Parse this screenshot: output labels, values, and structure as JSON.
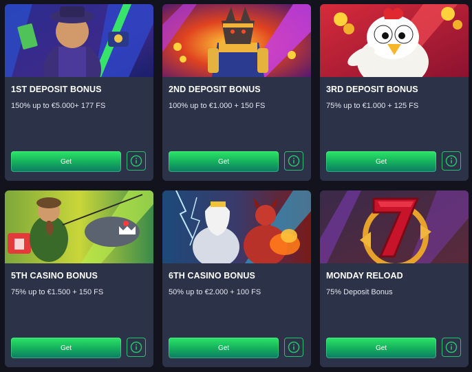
{
  "colors": {
    "page_bg": "#12131c",
    "card_bg": "#2c3349",
    "button_green": "#17b75c",
    "info_outline": "#27c26c"
  },
  "cards": [
    {
      "title": "1ST DEPOSIT BONUS",
      "desc": "150% up to €5.000+ 177 FS",
      "button": "Get",
      "info_icon": "info-circle-icon",
      "art": "gangster-slot-art"
    },
    {
      "title": "2ND DEPOSIT BONUS",
      "desc": "100% up to €1.000 + 150 FS",
      "button": "Get",
      "info_icon": "info-circle-icon",
      "art": "anubis-pharaoh-slot-art"
    },
    {
      "title": "3RD DEPOSIT BONUS",
      "desc": "75% up to €1.000 + 125 FS",
      "button": "Get",
      "info_icon": "info-circle-icon",
      "art": "chicken-slot-art"
    },
    {
      "title": "5TH CASINO BONUS",
      "desc": "75% up to €1.500 + 150 FS",
      "button": "Get",
      "info_icon": "info-circle-icon",
      "art": "fisherman-piranha-slot-art"
    },
    {
      "title": "6TH CASINO BONUS",
      "desc": "50% up to €2.000 + 100 FS",
      "button": "Get",
      "info_icon": "info-circle-icon",
      "art": "zeus-vs-hades-slot-art"
    },
    {
      "title": "MONDAY RELOAD",
      "desc": "75% Deposit Bonus",
      "button": "Get",
      "info_icon": "info-circle-icon",
      "art": "lucky-seven-art"
    }
  ]
}
